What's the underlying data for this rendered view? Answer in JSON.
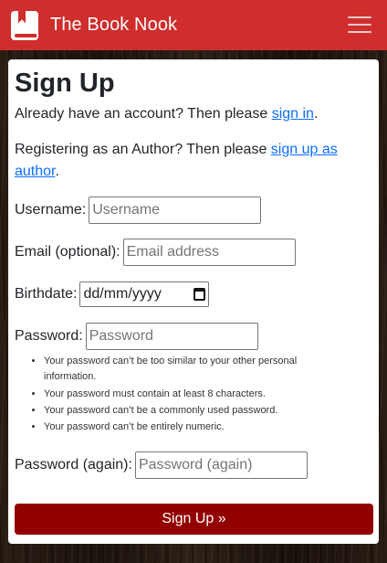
{
  "navbar": {
    "brand": "The Book Nook"
  },
  "form": {
    "title": "Sign Up",
    "signin_prefix": "Already have an account? Then please ",
    "signin_link": "sign in",
    "signin_suffix": ".",
    "author_prefix": "Registering as an Author? Then please ",
    "author_link": "sign up as author",
    "author_suffix": ".",
    "username_label": "Username:",
    "username_placeholder": "Username",
    "email_label": "Email (optional):",
    "email_placeholder": "Email address",
    "birthdate_label": "Birthdate:",
    "birthdate_value": "dd/mm/yyyy",
    "password_label": "Password:",
    "password_placeholder": "Password",
    "password_help": [
      "Your password can’t be too similar to your other personal information.",
      "Your password must contain at least 8 characters.",
      "Your password can’t be a commonly used password.",
      "Your password can’t be entirely numeric."
    ],
    "password2_label": "Password (again):",
    "password2_placeholder": "Password (again)",
    "submit_label": "Sign Up »"
  }
}
